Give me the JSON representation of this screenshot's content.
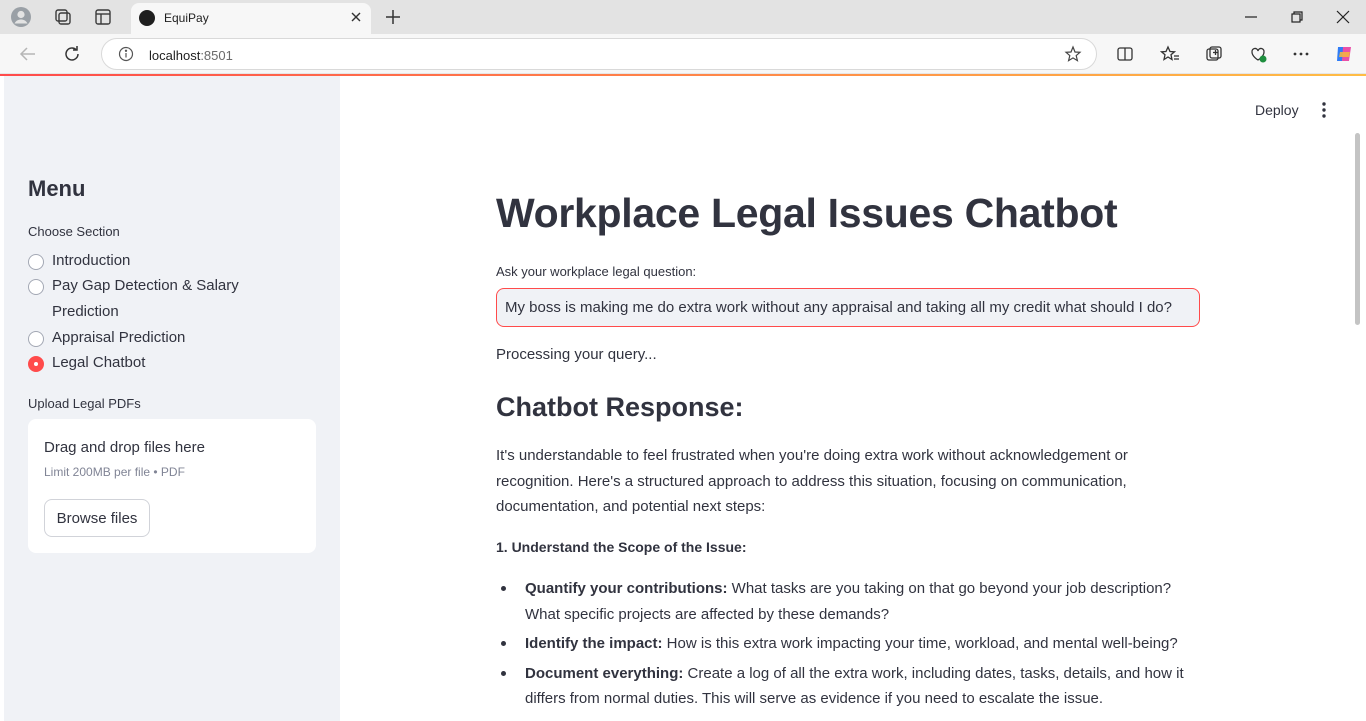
{
  "browser": {
    "tab_title": "EquiPay",
    "url_host": "localhost",
    "url_port": ":8501"
  },
  "sidebar": {
    "menu_title": "Menu",
    "choose_label": "Choose Section",
    "options": [
      {
        "label": "Introduction",
        "selected": false
      },
      {
        "label": "Pay Gap Detection & Salary Prediction",
        "selected": false
      },
      {
        "label": "Appraisal Prediction",
        "selected": false
      },
      {
        "label": "Legal Chatbot",
        "selected": true
      }
    ],
    "upload_label": "Upload Legal PDFs",
    "upload_main": "Drag and drop files here",
    "upload_sub": "Limit 200MB per file • PDF",
    "browse_label": "Browse files"
  },
  "header": {
    "deploy_label": "Deploy"
  },
  "main": {
    "title": "Workplace Legal Issues Chatbot",
    "question_label": "Ask your workplace legal question:",
    "question_value": "My boss is making me do extra work without any appraisal and taking all my credit what should I do?",
    "processing": "Processing your query...",
    "response_heading": "Chatbot Response:",
    "intro": "It's understandable to feel frustrated when you're doing extra work without acknowledgement or recognition. Here's a structured approach to address this situation, focusing on communication, documentation, and potential next steps:",
    "step_heading": "1. Understand the Scope of the Issue:",
    "bullets": [
      {
        "bold": "Quantify your contributions:",
        "text": " What tasks are you taking on that go beyond your job description? What specific projects are affected by these demands?"
      },
      {
        "bold": "Identify the impact:",
        "text": " How is this extra work impacting your time, workload, and mental well-being?"
      },
      {
        "bold": "Document everything:",
        "text": " Create a log of all the extra work, including dates, tasks, details, and how it differs from normal duties. This will serve as evidence if you need to escalate the issue."
      }
    ]
  },
  "colors": {
    "accent": "#ff4b4b",
    "sidebar_bg": "#f0f2f6",
    "text": "#31333f"
  }
}
